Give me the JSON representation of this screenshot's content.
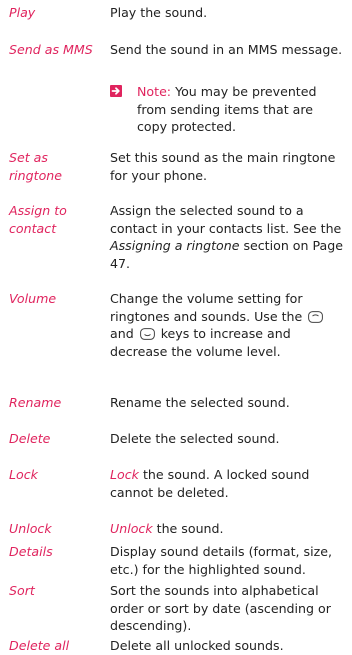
{
  "rows": [
    {
      "term": "Play",
      "desc": "Play the sound."
    },
    {
      "term": "Send as MMS",
      "desc": "Send the sound in an MMS message.",
      "note": {
        "label": "Note:",
        "text": "You may be prevented from sending items that are copy protected."
      }
    },
    {
      "term": "Set as ringtone",
      "desc": "Set this sound as the main ringtone for your phone."
    },
    {
      "term": "Assign to contact",
      "desc_a": "Assign the selected sound to a contact in your contacts list. See the ",
      "desc_ref": "Assigning a ringtone",
      "desc_b": " section on Page 47."
    },
    {
      "term": "Volume",
      "desc_a": "Change the volume setting for ringtones and sounds. Use the ",
      "desc_and": "and ",
      "desc_b": " keys to increase and decrease the volume level."
    },
    {
      "term": "Rename",
      "desc": "Rename the selected sound."
    },
    {
      "term": "Delete",
      "desc": "Delete the selected sound."
    },
    {
      "term": "Lock",
      "desc_word": "Lock",
      "desc_rest": " the sound. A locked sound cannot be deleted."
    },
    {
      "term": "Unlock",
      "desc_word": "Unlock",
      "desc_rest": " the sound."
    },
    {
      "term": "Details",
      "desc": "Display sound details (format, size, etc.) for the highlighted sound."
    },
    {
      "term": "Sort",
      "desc": "Sort the sounds into alphabetical order or sort by date (ascending or descending)."
    },
    {
      "term": "Delete all",
      "desc": "Delete all unlocked sounds."
    }
  ],
  "icons": {
    "note": "arrow-right-icon",
    "up_key": "scroll-up-key-icon",
    "down_key": "scroll-down-key-icon"
  },
  "colors": {
    "accent": "#e0245e",
    "text": "#222222"
  }
}
